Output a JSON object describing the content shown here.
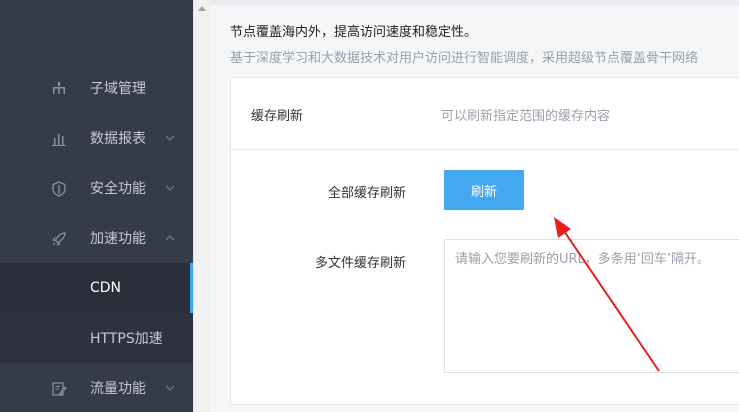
{
  "sidebar": {
    "items": [
      {
        "label": "子域管理",
        "icon": "sitemap-icon",
        "has_chevron": false
      },
      {
        "label": "数据报表",
        "icon": "bar-chart-icon",
        "has_chevron": true,
        "chevron": "down"
      },
      {
        "label": "安全功能",
        "icon": "shield-icon",
        "has_chevron": true,
        "chevron": "down"
      },
      {
        "label": "加速功能",
        "icon": "rocket-icon",
        "has_chevron": true,
        "chevron": "up"
      },
      {
        "label": "CDN",
        "active": true
      },
      {
        "label": "HTTPS加速"
      },
      {
        "label": "流量功能",
        "icon": "edit-icon",
        "has_chevron": true,
        "chevron": "down"
      }
    ]
  },
  "main": {
    "intro_line1": "节点覆盖海内外，提高访问速度和稳定性。",
    "intro_line2": "基于深度学习和大数据技术对用户访问进行智能调度，采用超级节点覆盖骨干网络",
    "card": {
      "title": "缓存刷新",
      "description": "可以刷新指定范围的缓存内容",
      "full_refresh_label": "全部缓存刷新",
      "refresh_button": "刷新",
      "multi_file_label": "多文件缓存刷新",
      "textarea_placeholder": "请输入您要刷新的URL，多条用‘回车’隔开。"
    }
  },
  "colors": {
    "sidebar_bg": "#363b49",
    "active_indicator": "#3aa7f5",
    "button_bg": "#44a8f0",
    "annotation_arrow": "#e8201c"
  }
}
